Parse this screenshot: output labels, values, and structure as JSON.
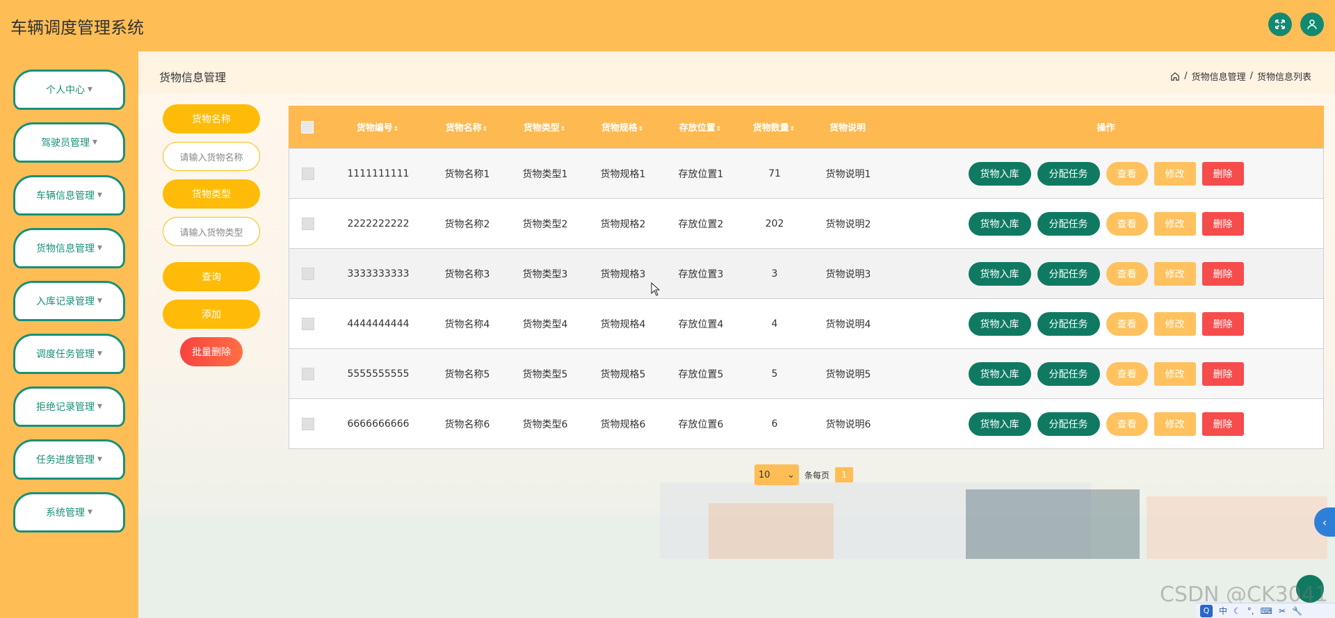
{
  "app": {
    "title": "车辆调度管理系统"
  },
  "header": {
    "fullscreen_icon": "expand-icon",
    "user_icon": "user-icon"
  },
  "sidebar": {
    "items": [
      {
        "label": "个人中心"
      },
      {
        "label": "驾驶员管理"
      },
      {
        "label": "车辆信息管理"
      },
      {
        "label": "货物信息管理"
      },
      {
        "label": "入库记录管理"
      },
      {
        "label": "调度任务管理"
      },
      {
        "label": "拒绝记录管理"
      },
      {
        "label": "任务进度管理"
      },
      {
        "label": "系统管理"
      }
    ]
  },
  "page": {
    "title": "货物信息管理",
    "breadcrumb": [
      "货物信息管理",
      "货物信息列表"
    ],
    "breadcrumb_sep": "/"
  },
  "search": {
    "name_label": "货物名称",
    "name_placeholder": "请输入货物名称",
    "type_label": "货物类型",
    "type_placeholder": "请输入货物类型",
    "query_button": "查询",
    "add_button": "添加",
    "batch_delete_button": "批量删除"
  },
  "table": {
    "columns": [
      "货物编号",
      "货物名称",
      "货物类型",
      "货物规格",
      "存放位置",
      "货物数量",
      "货物说明",
      "操作"
    ],
    "sort_glyph": "⇕",
    "rows": [
      [
        "1111111111",
        "货物名称1",
        "货物类型1",
        "货物规格1",
        "存放位置1",
        "71",
        "货物说明1"
      ],
      [
        "2222222222",
        "货物名称2",
        "货物类型2",
        "货物规格2",
        "存放位置2",
        "202",
        "货物说明2"
      ],
      [
        "3333333333",
        "货物名称3",
        "货物类型3",
        "货物规格3",
        "存放位置3",
        "3",
        "货物说明3"
      ],
      [
        "4444444444",
        "货物名称4",
        "货物类型4",
        "货物规格4",
        "存放位置4",
        "4",
        "货物说明4"
      ],
      [
        "5555555555",
        "货物名称5",
        "货物类型5",
        "货物规格5",
        "存放位置5",
        "5",
        "货物说明5"
      ],
      [
        "6666666666",
        "货物名称6",
        "货物类型6",
        "货物规格6",
        "存放位置6",
        "6",
        "货物说明6"
      ]
    ],
    "actions": [
      "货物入库",
      "分配任务",
      "查看",
      "修改",
      "删除"
    ]
  },
  "pagination": {
    "page_size": "10",
    "per_page_label": "条每页",
    "current_page": "1"
  },
  "overlay": {
    "watermark": "CSDN @CK3041",
    "tray_items": [
      "Q",
      "中",
      "☾",
      "°,",
      "⌨",
      "✂",
      "🔧"
    ]
  },
  "colors": {
    "primary": "#ffbe55",
    "accent_green": "#0f7a61",
    "sidebar_border": "#179079",
    "danger": "#f64c4c",
    "button_yellow": "#ffbb08"
  }
}
